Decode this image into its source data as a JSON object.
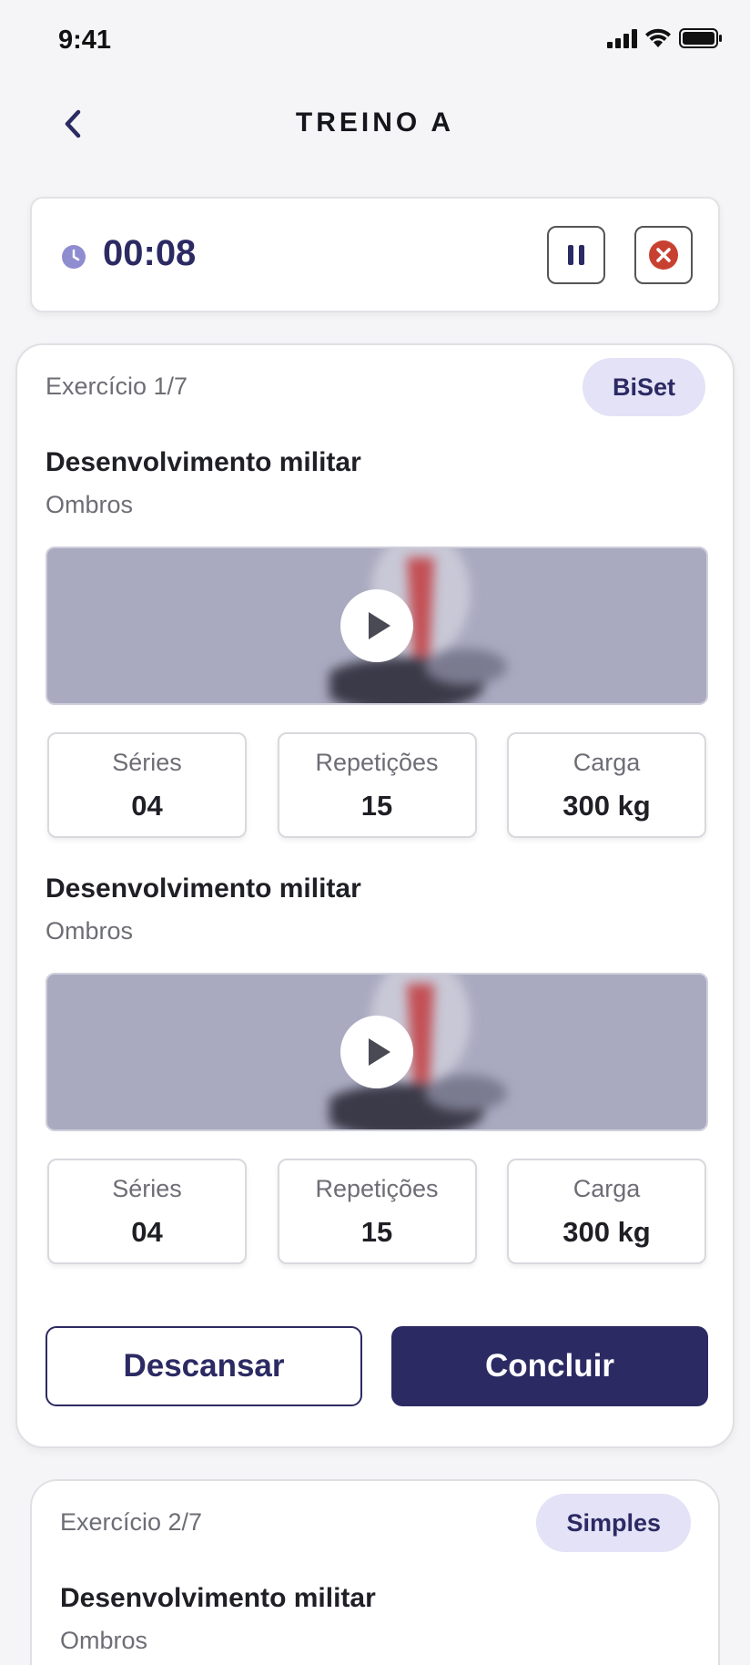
{
  "status_bar": {
    "time": "9:41"
  },
  "header": {
    "title": "TREINO A"
  },
  "timer": {
    "value": "00:08"
  },
  "colors": {
    "primary": "#2c2a63",
    "tag_bg": "#e3e2f7",
    "stop": "#c84130",
    "thumb_bg": "#a9a9c0"
  },
  "exercise_1": {
    "index_label": "Exercício 1/7",
    "tag": "BiSet",
    "items": [
      {
        "name": "Desenvolvimento militar",
        "muscle": "Ombros",
        "stats": [
          {
            "label": "Séries",
            "value": "04"
          },
          {
            "label": "Repetições",
            "value": "15"
          },
          {
            "label": "Carga",
            "value": "300 kg"
          }
        ]
      },
      {
        "name": "Desenvolvimento militar",
        "muscle": "Ombros",
        "stats": [
          {
            "label": "Séries",
            "value": "04"
          },
          {
            "label": "Repetições",
            "value": "15"
          },
          {
            "label": "Carga",
            "value": "300 kg"
          }
        ]
      }
    ],
    "rest_label": "Descansar",
    "done_label": "Concluir"
  },
  "exercise_2": {
    "index_label": "Exercício 2/7",
    "tag": "Simples",
    "name": "Desenvolvimento militar",
    "muscle": "Ombros"
  }
}
